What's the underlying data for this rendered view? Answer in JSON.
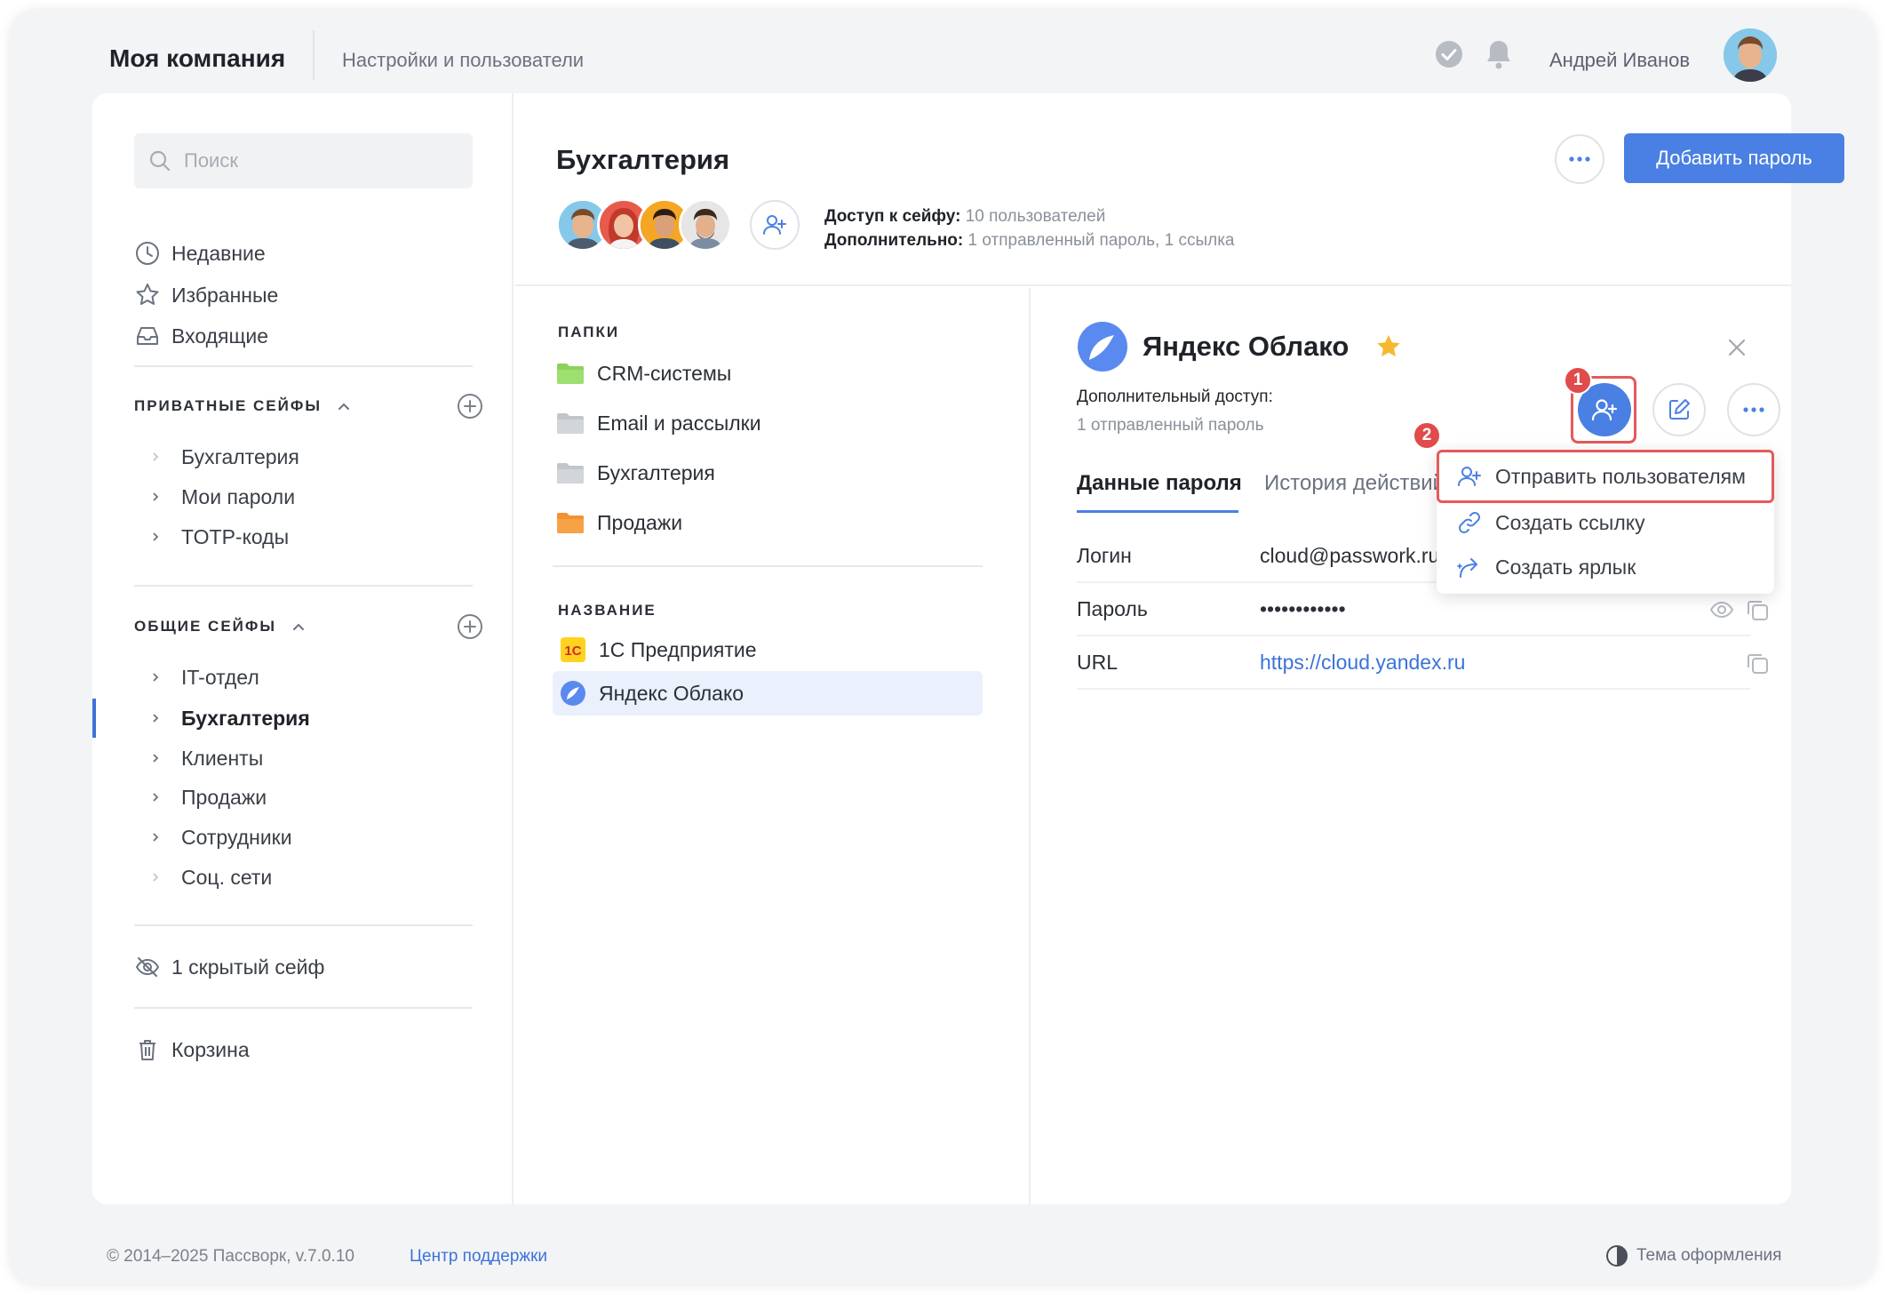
{
  "header": {
    "company": "Моя компания",
    "settings_link": "Настройки и пользователи",
    "user_name": "Андрей Иванов"
  },
  "sidebar": {
    "search_placeholder": "Поиск",
    "nav": [
      {
        "label": "Недавние",
        "icon": "clock-icon"
      },
      {
        "label": "Избранные",
        "icon": "star-icon"
      },
      {
        "label": "Входящие",
        "icon": "inbox-icon"
      }
    ],
    "private_section": {
      "title": "ПРИВАТНЫЕ СЕЙФЫ",
      "items": [
        "Бухгалтерия",
        "Мои пароли",
        "TOTP-коды"
      ]
    },
    "shared_section": {
      "title": "ОБЩИЕ СЕЙФЫ",
      "items": [
        "IT-отдел",
        "Бухгалтерия",
        "Клиенты",
        "Продажи",
        "Сотрудники",
        "Соц. сети"
      ],
      "active_index": 1
    },
    "hidden_vaults": "1 скрытый сейф",
    "trash": "Корзина"
  },
  "vault": {
    "title": "Бухгалтерия",
    "access_label": "Доступ к сейфу:",
    "access_value": "10 пользователей",
    "extra_label": "Дополнительно:",
    "extra_value": "1 отправленный пароль, 1 ссылка",
    "add_password_button": "Добавить пароль"
  },
  "list": {
    "folders_label": "ПАПКИ",
    "folders": [
      {
        "label": "CRM-системы",
        "color": "#8bd25a"
      },
      {
        "label": "Email и рассылки",
        "color": "#c9ccd1"
      },
      {
        "label": "Бухгалтерия",
        "color": "#c9ccd1"
      },
      {
        "label": "Продажи",
        "color": "#f7a247"
      }
    ],
    "entries_label": "НАЗВАНИЕ",
    "entries": [
      {
        "label": "1С Предприятие",
        "icon": "1c-logo-icon"
      },
      {
        "label": "Яндекс Облако",
        "icon": "yandex-cloud-icon",
        "selected": true
      }
    ]
  },
  "detail": {
    "title": "Яндекс Облако",
    "extra_access_label": "Дополнительный доступ:",
    "extra_access_value": "1 отправленный пароль",
    "tabs": [
      "Данные пароля",
      "История действий"
    ],
    "fields": [
      {
        "key": "Логин",
        "value": "cloud@passwork.ru"
      },
      {
        "key": "Пароль",
        "value": "••••••••••••"
      },
      {
        "key": "URL",
        "value": "https://cloud.yandex.ru"
      }
    ],
    "badges": [
      "1",
      "2"
    ]
  },
  "dropdown": {
    "items": [
      "Отправить пользователям",
      "Создать ссылку",
      "Создать ярлык"
    ]
  },
  "footer": {
    "copyright": "© 2014–2025 Пассворк, v.7.0.10",
    "support": "Центр поддержки",
    "theme": "Тема оформления"
  },
  "colors": {
    "accent": "#4a80e3",
    "highlight": "#e55a5a",
    "star": "#f5b82e"
  }
}
